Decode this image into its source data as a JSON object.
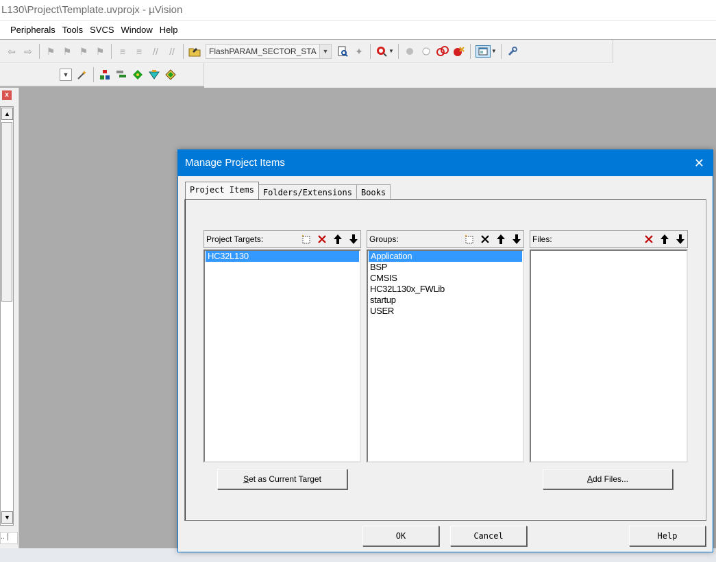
{
  "window": {
    "title": "L130\\Project\\Template.uvprojx - µVision"
  },
  "menu": [
    {
      "label": "Peripherals"
    },
    {
      "label": "Tools"
    },
    {
      "label": "SVCS"
    },
    {
      "label": "Window"
    },
    {
      "label": "Help"
    }
  ],
  "toolbar": {
    "define_combo": "FlashPARAM_SECTOR_STA"
  },
  "dialog": {
    "title": "Manage Project Items",
    "close_glyph": "✕",
    "tabs": [
      {
        "label": "Project Items",
        "active": true
      },
      {
        "label": "Folders/Extensions",
        "active": false
      },
      {
        "label": "Books",
        "active": false
      }
    ],
    "targets": {
      "label": "Project Targets:",
      "items": [
        "HC32L130"
      ],
      "selected_index": 0
    },
    "groups": {
      "label": "Groups:",
      "items": [
        "Application",
        "BSP",
        "CMSIS",
        "HC32L130x_FWLib",
        "startup",
        "USER"
      ],
      "selected_index": 0
    },
    "files": {
      "label": "Files:",
      "items": []
    },
    "set_target_button": {
      "accel": "S",
      "rest": "et as Current Target"
    },
    "add_files_button": {
      "accel": "A",
      "rest": "dd Files..."
    },
    "ok_button": "OK",
    "cancel_button": "Cancel",
    "help_button": "Help"
  },
  "colors": {
    "accent": "#0078d7",
    "selection": "#3399ff",
    "delete_red": "#c00000"
  },
  "icons": {
    "new": "new-item-icon",
    "delete": "delete-icon",
    "up": "move-up-icon",
    "down": "move-down-icon"
  }
}
